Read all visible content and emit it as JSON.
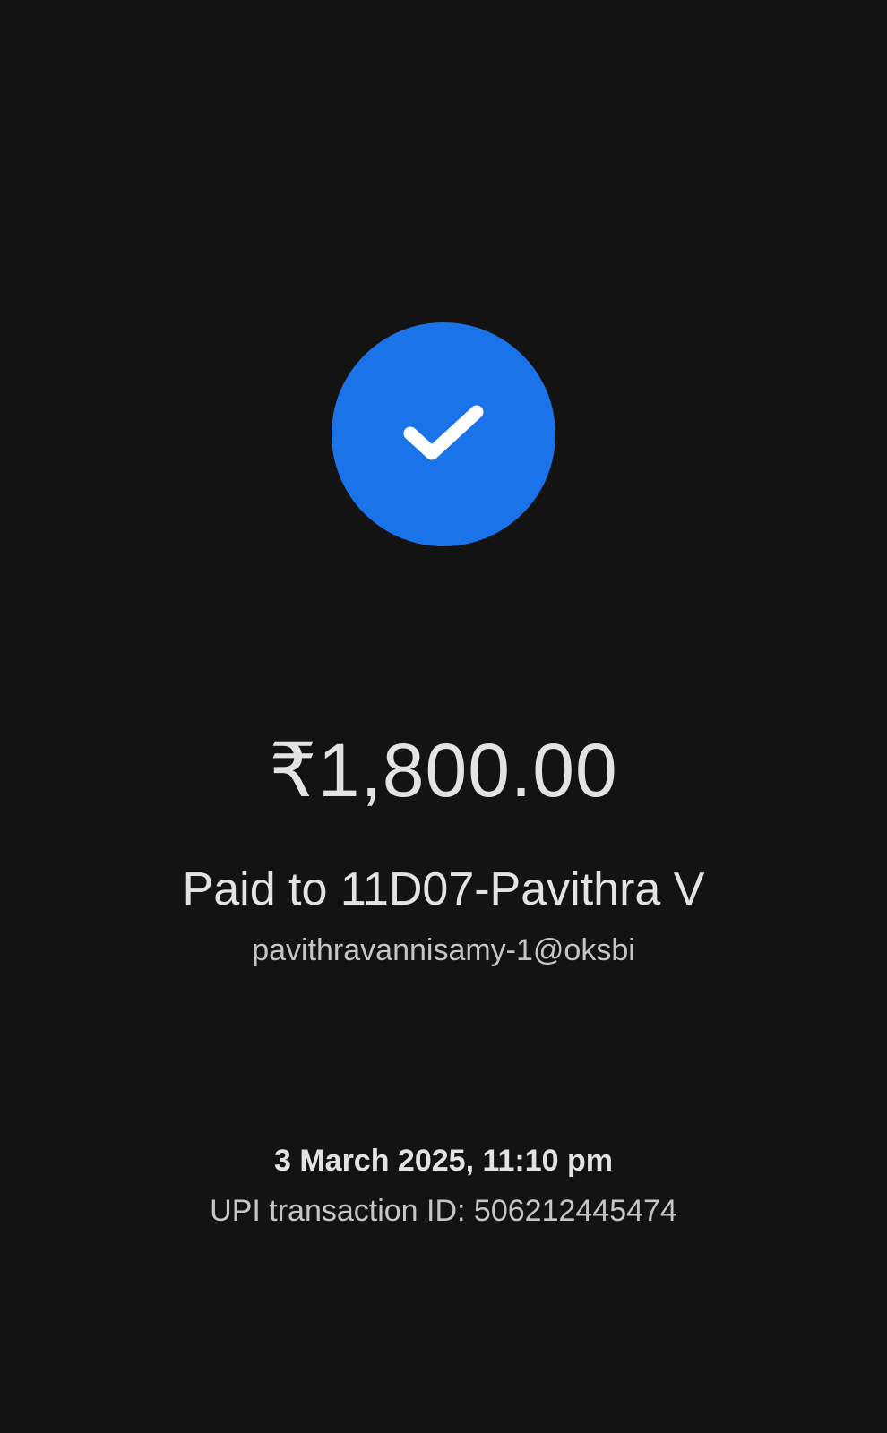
{
  "status": {
    "icon": "checkmark-icon",
    "color": "#1a73e8"
  },
  "payment": {
    "amount": "₹1,800.00",
    "paid_to": "Paid to 11D07-Pavithra V",
    "upi_id": "pavithravannisamy-1@oksbi",
    "datetime": "3 March 2025, 11:10 pm",
    "transaction_id": "UPI transaction ID: 506212445474"
  }
}
